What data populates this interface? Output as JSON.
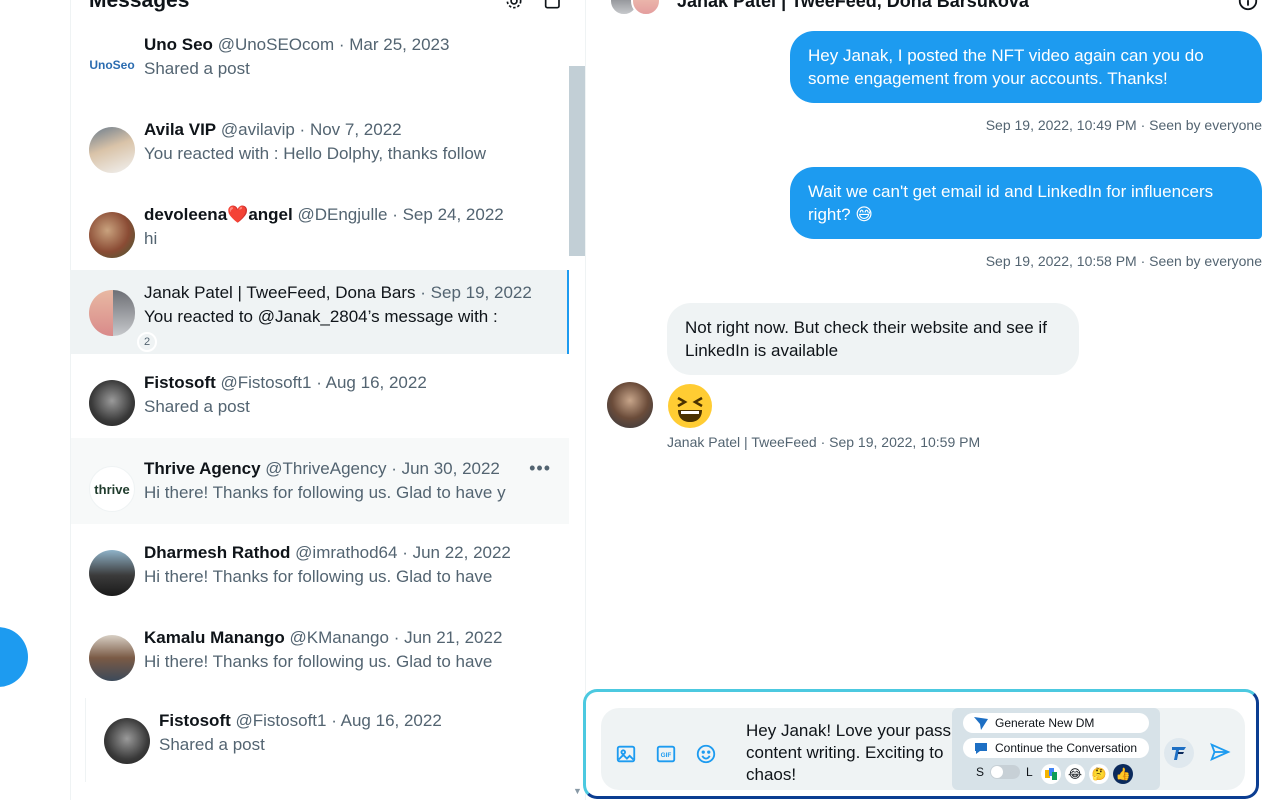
{
  "messages": {
    "title": "Messages",
    "conversations": [
      {
        "name": "Uno Seo",
        "handle": "@UnoSEOcom",
        "sep": " · ",
        "date": "Mar 25, 2023",
        "preview": "Shared a post",
        "avatar_text": "UnoSeo"
      },
      {
        "name": "Avila VIP",
        "handle": "@avilavip",
        "sep": " · ",
        "date": "Nov 7, 2022",
        "preview": "You reacted with : Hello Dolphy, thanks follow"
      },
      {
        "name": "devoleena❤️angel",
        "handle": "@DEngjulle",
        "sep": " · ",
        "date": "Sep 24, 2022",
        "preview": "hi"
      },
      {
        "name": "Janak Patel | TweeFeed, Dona Bars",
        "handle": "",
        "sep": " · ",
        "date": "Sep 19, 2022",
        "preview": "You reacted to @Janak_2804’s message with :",
        "badge": "2"
      },
      {
        "name": "Fistosoft",
        "handle": "@Fistosoft1",
        "sep": " · ",
        "date": "Aug 16, 2022",
        "preview": "Shared a post"
      },
      {
        "name": "Thrive Agency",
        "handle": "@ThriveAgency",
        "sep": " · ",
        "date": "Jun 30, 2022",
        "preview": "Hi there! Thanks for following us. Glad to have y",
        "avatar_text": "thrive"
      },
      {
        "name": "Dharmesh Rathod",
        "handle": "@imrathod64",
        "sep": " · ",
        "date": "Jun 22, 2022",
        "preview": "Hi there! Thanks for following us. Glad to have"
      },
      {
        "name": "Kamalu Manango",
        "handle": "@KManango",
        "sep": " · ",
        "date": "Jun 21, 2022",
        "preview": "Hi there! Thanks for following us. Glad to have"
      },
      {
        "name": "Fistosoft",
        "handle": "@Fistosoft1",
        "sep": " · ",
        "date": "Aug 16, 2022",
        "preview": "Shared a post"
      }
    ]
  },
  "chat": {
    "title": "Janak Patel | TweeFeed, Dona Barsukova",
    "outgoing": [
      {
        "text": "Hey Janak, I posted the NFT video again can you do some engagement from your accounts. Thanks!",
        "meta": "Sep 19, 2022, 10:49 PM · Seen by everyone"
      },
      {
        "text": "Wait we can't get email id and LinkedIn for influencers right? 😅",
        "meta": "Sep 19, 2022, 10:58 PM · Seen by everyone"
      }
    ],
    "incoming": {
      "text": "Not right now. But check their website and see if LinkedIn is available",
      "emoji": "😆",
      "meta": "Janak Patel | TweeFeed · Sep 19, 2022, 10:59 PM"
    }
  },
  "composer": {
    "draft": "Hey Janak! Love your passi content writing. Exciting to chaos!",
    "draft_lines": [
      "Hey Janak! Love your passi",
      "content writing. Exciting to",
      "chaos!"
    ],
    "ai": {
      "generate_label": "Generate New DM",
      "continue_label": "Continue the Conversation",
      "toggle_left": "S",
      "toggle_right": "L"
    }
  },
  "colors": {
    "accent": "#1d9bf0",
    "selected_bg": "#eff3f4"
  },
  "icons": [
    "settings-icon",
    "new-message-icon",
    "info-icon",
    "image-icon",
    "gif-icon",
    "emoji-icon",
    "send-icon"
  ]
}
